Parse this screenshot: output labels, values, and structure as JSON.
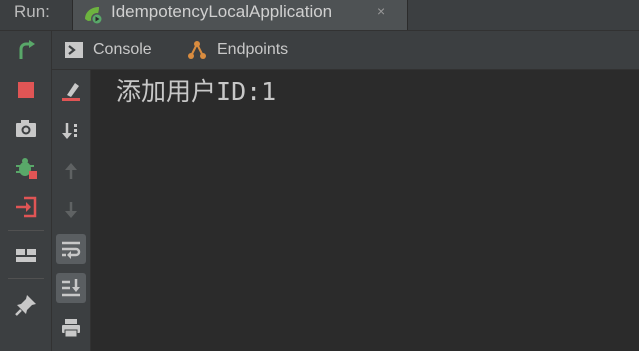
{
  "run_bar": {
    "label": "Run:",
    "tab_title": "IdempotencyLocalApplication",
    "tab_close": "×",
    "tab_icon": "spring-boot-run-icon"
  },
  "left_toolbar": {
    "buttons": [
      {
        "icon": "rerun-icon",
        "color": "#59a869"
      },
      {
        "icon": "stop-icon",
        "color": "#e05555"
      },
      {
        "icon": "camera-icon",
        "color": "#c8c8c8"
      },
      {
        "icon": "debug-bug-icon",
        "color": "#59a869"
      },
      {
        "icon": "exit-icon",
        "color": "#e05555"
      },
      {
        "icon": "layout-icon",
        "color": "#c8c8c8"
      },
      {
        "icon": "pin-icon",
        "color": "#c8c8c8"
      }
    ]
  },
  "tabs": {
    "console_label": "Console",
    "endpoints_label": "Endpoints"
  },
  "console_toolbar": {
    "buttons": [
      {
        "icon": "clear-all-icon"
      },
      {
        "icon": "sort-down-icon"
      },
      {
        "icon": "up-arrow-icon",
        "state": "disabled"
      },
      {
        "icon": "down-arrow-icon",
        "state": "disabled"
      },
      {
        "icon": "soft-wrap-icon",
        "state": "active"
      },
      {
        "icon": "scroll-to-end-icon",
        "state": "active"
      },
      {
        "icon": "print-icon"
      }
    ]
  },
  "console": {
    "text_cn": "添加用户",
    "text_id": "ID:1"
  },
  "colors": {
    "background": "#2b2b2b",
    "toolbar": "#3c3f41",
    "text": "#c8c8c8",
    "accent_green": "#59a869",
    "accent_red": "#e05555"
  }
}
